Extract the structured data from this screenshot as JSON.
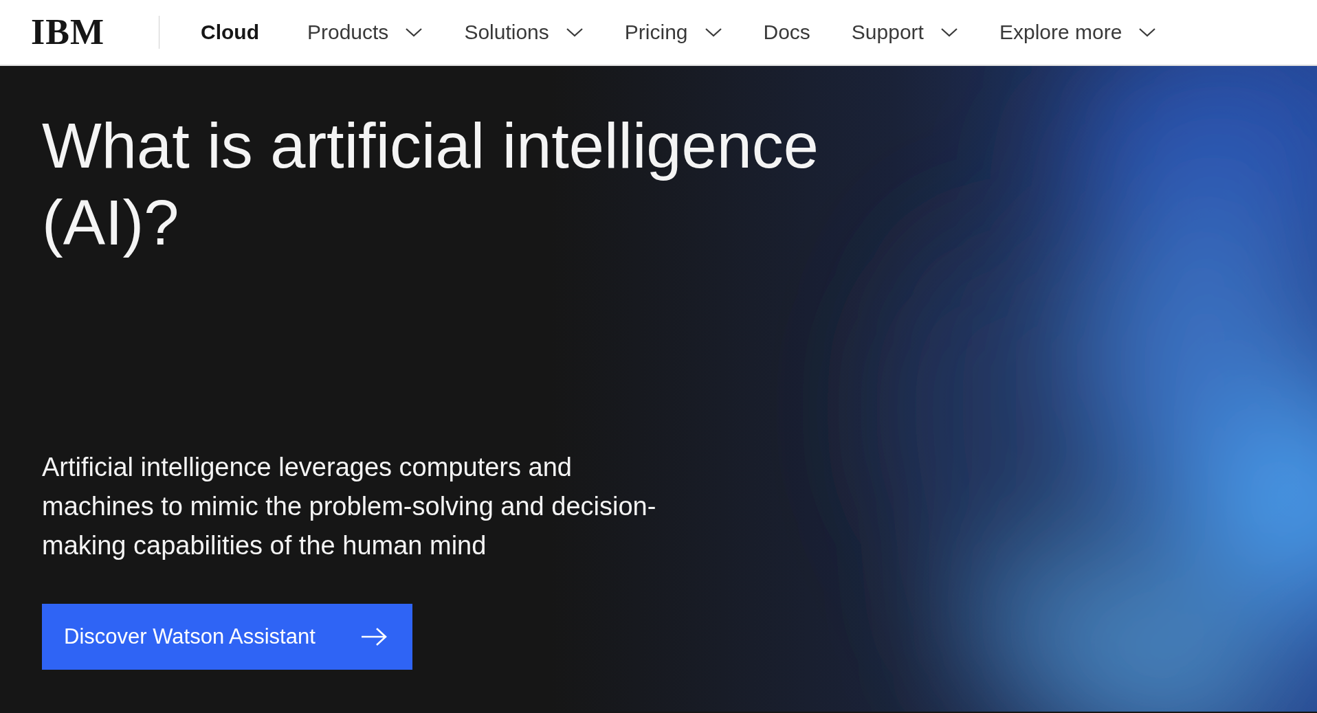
{
  "nav": {
    "logo": "IBM",
    "brand": "Cloud",
    "items": [
      {
        "label": "Products",
        "dropdown": true
      },
      {
        "label": "Solutions",
        "dropdown": true
      },
      {
        "label": "Pricing",
        "dropdown": true
      },
      {
        "label": "Docs",
        "dropdown": false
      },
      {
        "label": "Support",
        "dropdown": true
      },
      {
        "label": "Explore more",
        "dropdown": true
      }
    ]
  },
  "hero": {
    "title": "What is artificial intelligence (AI)?",
    "description": "Artificial intelligence leverages computers and machines to mimic the problem-solving and decision-making capabilities of the human mind",
    "button": "Discover Watson Assistant"
  }
}
